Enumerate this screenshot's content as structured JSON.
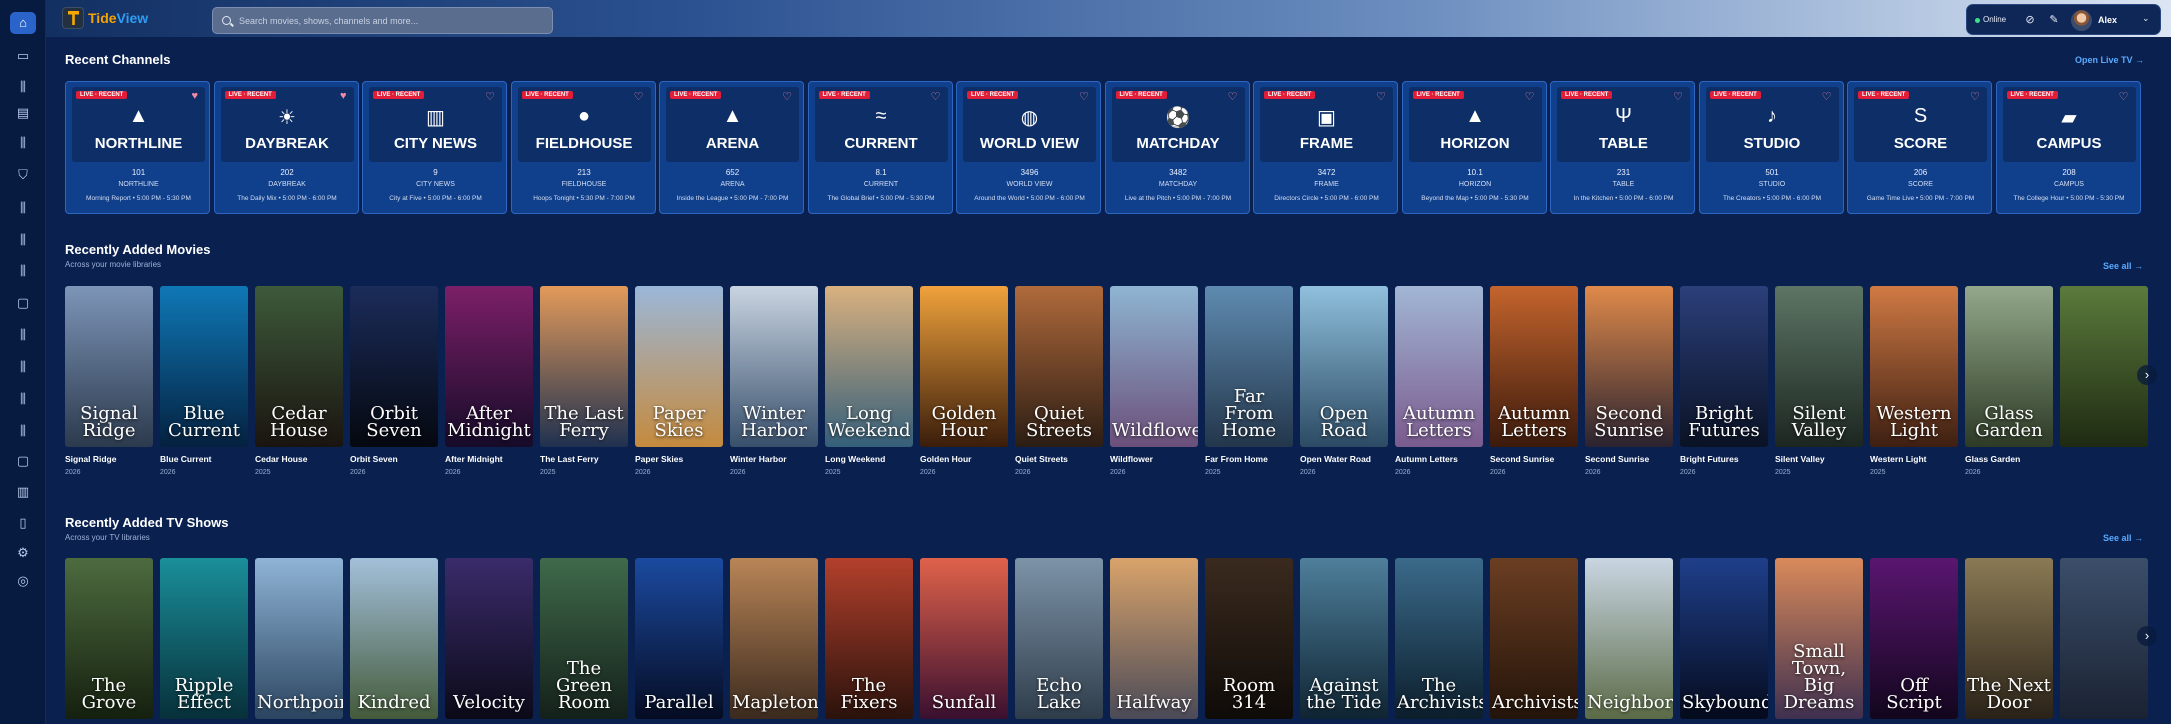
{
  "app": {
    "brand_a": "Tide",
    "brand_b": "View"
  },
  "search": {
    "placeholder": "Search movies, shows, channels and more..."
  },
  "user": {
    "status": "Online",
    "name": "Alex"
  },
  "sidebar_icons": [
    "home-icon",
    "live-tv-icon",
    "library-icon",
    "guide-icon",
    "library-icon",
    "bookmark-icon",
    "library-icon",
    "library-icon",
    "library-icon",
    "chat-icon",
    "library-icon",
    "library-icon",
    "library-icon",
    "library-icon",
    "chat-icon",
    "books-icon",
    "book-icon",
    "settings-icon",
    "help-icon"
  ],
  "recent_channels": {
    "title": "Recent Channels",
    "link": "Open Live TV",
    "live_tag": "LIVE · RECENT",
    "items": [
      {
        "brand": "NORTHLINE",
        "num": "101",
        "name": "NORTHLINE",
        "program": "Morning Report • 5:00 PM - 5:30 PM",
        "icon": "mountain-icon",
        "glyph": "▲",
        "favorite": true
      },
      {
        "brand": "DAYBREAK",
        "num": "202",
        "name": "DAYBREAK",
        "program": "The Daily Mix • 5:00 PM - 6:00 PM",
        "icon": "sunrise-icon",
        "glyph": "☀",
        "favorite": true
      },
      {
        "brand": "CITY NEWS",
        "num": "9",
        "name": "CITY NEWS",
        "program": "City at Five • 5:00 PM - 6:00 PM",
        "icon": "skyline-icon",
        "glyph": "▥",
        "favorite": false
      },
      {
        "brand": "FIELDHOUSE",
        "num": "213",
        "name": "FIELDHOUSE",
        "program": "Hoops Tonight • 5:30 PM - 7:00 PM",
        "icon": "basketball-icon",
        "glyph": "●",
        "favorite": false
      },
      {
        "brand": "ARENA",
        "num": "652",
        "name": "ARENA",
        "program": "Inside the League • 5:00 PM - 7:00 PM",
        "icon": "arena-icon",
        "glyph": "▲",
        "favorite": false
      },
      {
        "brand": "CURRENT",
        "num": "8.1",
        "name": "CURRENT",
        "program": "The Global Brief • 5:00 PM - 5:30 PM",
        "icon": "wave-icon",
        "glyph": "≈",
        "favorite": false
      },
      {
        "brand": "WORLD VIEW",
        "num": "3496",
        "name": "WORLD VIEW",
        "program": "Around the World • 5:00 PM - 6:00 PM",
        "icon": "globe-icon",
        "glyph": "◍",
        "favorite": false
      },
      {
        "brand": "MATCHDAY",
        "num": "3482",
        "name": "MATCHDAY",
        "program": "Live at the Pitch • 5:00 PM - 7:00 PM",
        "icon": "soccer-ball-icon",
        "glyph": "⚽",
        "favorite": false
      },
      {
        "brand": "FRAME",
        "num": "3472",
        "name": "FRAME",
        "program": "Directors Circle • 5:00 PM - 6:00 PM",
        "icon": "camera-icon",
        "glyph": "▣",
        "favorite": false
      },
      {
        "brand": "HORIZON",
        "num": "10.1",
        "name": "HORIZON",
        "program": "Beyond the Map • 5:00 PM - 5:30 PM",
        "icon": "mountain-icon",
        "glyph": "▲",
        "favorite": false
      },
      {
        "brand": "TABLE",
        "num": "231",
        "name": "TABLE",
        "program": "In the Kitchen • 5:00 PM - 6:00 PM",
        "icon": "fork-knife-icon",
        "glyph": "Ψ",
        "favorite": false
      },
      {
        "brand": "STUDIO",
        "num": "501",
        "name": "STUDIO",
        "program": "The Creators • 5:00 PM - 6:00 PM",
        "icon": "microphone-icon",
        "glyph": "♪",
        "favorite": false
      },
      {
        "brand": "SCORE",
        "num": "206",
        "name": "SCORE",
        "program": "Game Time Live • 5:00 PM - 7:00 PM",
        "icon": "score-icon",
        "glyph": "S",
        "favorite": false
      },
      {
        "brand": "CAMPUS",
        "num": "208",
        "name": "CAMPUS",
        "program": "The College Hour • 5:00 PM - 5:30 PM",
        "icon": "graduation-cap-icon",
        "glyph": "▰",
        "favorite": false
      }
    ]
  },
  "movies": {
    "title": "Recently Added Movies",
    "subtitle": "Across your movie libraries",
    "link": "See all",
    "items": [
      {
        "art": "Signal Ridge",
        "name": "Signal Ridge",
        "year": "2026",
        "c1": "#7d95b8",
        "c2": "#2c3a4d"
      },
      {
        "art": "Blue Current",
        "name": "Blue Current",
        "year": "2026",
        "c1": "#0f78b6",
        "c2": "#04213f"
      },
      {
        "art": "Cedar House",
        "name": "Cedar House",
        "year": "2025",
        "c1": "#3d5a3a",
        "c2": "#1a1410"
      },
      {
        "art": "Orbit Seven",
        "name": "Orbit Seven",
        "year": "2026",
        "c1": "#1b2c5a",
        "c2": "#05080f"
      },
      {
        "art": "After Midnight",
        "name": "After Midnight",
        "year": "2026",
        "c1": "#7c1f68",
        "c2": "#150b28"
      },
      {
        "art": "The Last Ferry",
        "name": "The Last Ferry",
        "year": "2025",
        "c1": "#e39a5a",
        "c2": "#1f3150"
      },
      {
        "art": "Paper Skies",
        "name": "Paper Skies",
        "year": "2026",
        "c1": "#9bb7d9",
        "c2": "#c58a3d"
      },
      {
        "art": "Winter Harbor",
        "name": "Winter Harbor",
        "year": "2026",
        "c1": "#c9d4e1",
        "c2": "#38506c"
      },
      {
        "art": "Long Weekend",
        "name": "Long Weekend",
        "year": "2025",
        "c1": "#d9b17f",
        "c2": "#355f7a"
      },
      {
        "art": "Golden Hour",
        "name": "Golden Hour",
        "year": "2026",
        "c1": "#f0a23c",
        "c2": "#3a1d0b"
      },
      {
        "art": "Quiet Streets",
        "name": "Quiet Streets",
        "year": "2026",
        "c1": "#b06a3b",
        "c2": "#2b1d14"
      },
      {
        "art": "Wildflower",
        "name": "Wildflower",
        "year": "2026",
        "c1": "#8eb5d2",
        "c2": "#6b4f7a"
      },
      {
        "art": "Far From Home",
        "name": "Far From Home",
        "year": "2025",
        "c1": "#5f8bb0",
        "c2": "#23364b"
      },
      {
        "art": "Open Road",
        "name": "Open Water Road",
        "year": "2026",
        "c1": "#8fc0dd",
        "c2": "#2c4a63"
      },
      {
        "art": "Autumn Letters",
        "name": "Autumn Letters",
        "year": "2026",
        "c1": "#a2b6d5",
        "c2": "#7a5b8e"
      },
      {
        "art": "Autumn Letters",
        "name": "Second Sunrise",
        "year": "2026",
        "c1": "#c4642d",
        "c2": "#3b1a0c"
      },
      {
        "art": "Second Sunrise",
        "name": "Second Sunrise",
        "year": "2026",
        "c1": "#e08a4a",
        "c2": "#2a2330"
      },
      {
        "art": "Bright Futures",
        "name": "Bright Futures",
        "year": "2026",
        "c1": "#2b3f7a",
        "c2": "#0a1224"
      },
      {
        "art": "Silent Valley",
        "name": "Silent Valley",
        "year": "2025",
        "c1": "#5d7565",
        "c2": "#1c2620"
      },
      {
        "art": "Western Light",
        "name": "Western Light",
        "year": "2025",
        "c1": "#d07a44",
        "c2": "#3d1f12"
      },
      {
        "art": "Glass Garden",
        "name": "Glass Garden",
        "year": "2026",
        "c1": "#93a98a",
        "c2": "#2d3a26"
      },
      {
        "art": "",
        "name": "",
        "year": "",
        "c1": "#5b7b3c",
        "c2": "#1e2a12"
      }
    ]
  },
  "shows": {
    "title": "Recently Added TV Shows",
    "subtitle": "Across your TV libraries",
    "link": "See all",
    "items": [
      {
        "art": "The Grove",
        "c1": "#4d6b3f",
        "c2": "#15200f"
      },
      {
        "art": "Ripple Effect",
        "c1": "#1a8f9a",
        "c2": "#07303a"
      },
      {
        "art": "Northpoint",
        "c1": "#8fb4d6",
        "c2": "#2b4560"
      },
      {
        "art": "Kindred",
        "c1": "#a3c0da",
        "c2": "#445a3a"
      },
      {
        "art": "Velocity",
        "c1": "#3a2b6a",
        "c2": "#0b0a18"
      },
      {
        "art": "The Green Room",
        "c1": "#3f6a4a",
        "c2": "#14201a"
      },
      {
        "art": "Parallel",
        "c1": "#1b4aa0",
        "c2": "#050c22"
      },
      {
        "art": "Mapleton",
        "c1": "#b98557",
        "c2": "#3b2a1e"
      },
      {
        "art": "The Fixers",
        "c1": "#b3402c",
        "c2": "#2a120c"
      },
      {
        "art": "Sunfall",
        "c1": "#e0624a",
        "c2": "#3a1030"
      },
      {
        "art": "Echo Lake",
        "c1": "#7d93a8",
        "c2": "#2f3d4b"
      },
      {
        "art": "Halfway",
        "c1": "#d9a36a",
        "c2": "#4a4a58"
      },
      {
        "art": "Room 314",
        "c1": "#3a2a1e",
        "c2": "#0f0b08"
      },
      {
        "art": "Against the Tide",
        "c1": "#4e7f9b",
        "c2": "#0f2432"
      },
      {
        "art": "The Archivists",
        "c1": "#3a6a8a",
        "c2": "#0c1e2c"
      },
      {
        "art": "Archivists",
        "c1": "#6b3e22",
        "c2": "#23140a"
      },
      {
        "art": "Neighborly",
        "c1": "#c9d6e3",
        "c2": "#5b6b46"
      },
      {
        "art": "Skybound",
        "c1": "#1f3f8a",
        "c2": "#050b1d"
      },
      {
        "art": "Small Town, Big Dreams",
        "c1": "#d98a5a",
        "c2": "#3f3050"
      },
      {
        "art": "Off Script",
        "c1": "#5a1670",
        "c2": "#12061d"
      },
      {
        "art": "The Next Door",
        "c1": "#8a7a54",
        "c2": "#2a2218"
      },
      {
        "art": "",
        "c1": "#3b4e6a",
        "c2": "#1a2232"
      }
    ]
  }
}
